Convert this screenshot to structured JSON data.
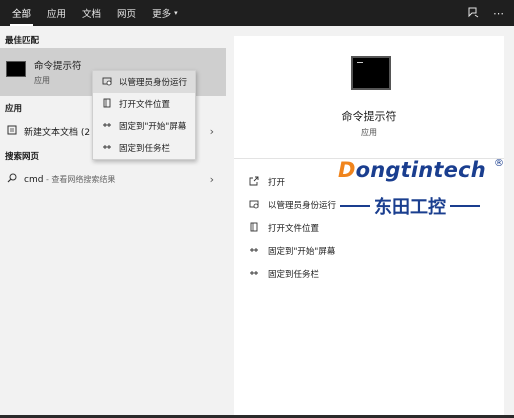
{
  "tabs": {
    "all": "全部",
    "apps": "应用",
    "docs": "文档",
    "web": "网页",
    "more": "更多",
    "more_caret": "▾"
  },
  "top_icons": {
    "feedback": "feedback-icon",
    "more": "⋯"
  },
  "left": {
    "best_match_title": "最佳匹配",
    "best_match": {
      "name": "命令提示符",
      "type": "应用"
    },
    "apps_title": "应用",
    "app_item": {
      "label": "新建文本文档 (2"
    },
    "web_title": "搜索网页",
    "web_item": {
      "label": "cmd",
      "sub": " - 查看网络搜索结果"
    }
  },
  "context_menu": {
    "items": [
      {
        "label": "以管理员身份运行"
      },
      {
        "label": "打开文件位置"
      },
      {
        "label": "固定到\"开始\"屏幕"
      },
      {
        "label": "固定到任务栏"
      }
    ]
  },
  "right": {
    "name": "命令提示符",
    "type": "应用",
    "actions": [
      {
        "label": "打开"
      },
      {
        "label": "以管理员身份运行"
      },
      {
        "label": "打开文件位置"
      },
      {
        "label": "固定到\"开始\"屏幕"
      },
      {
        "label": "固定到任务栏"
      }
    ]
  },
  "watermark": {
    "latin_first": "D",
    "latin_rest": "ongtintech",
    "registered": "®",
    "cn": "东田工控"
  },
  "colors": {
    "topbar": "#1f1f1f",
    "selected": "#cfcfcf",
    "brand_blue": "#1a3e8f",
    "brand_orange": "#f0841c"
  }
}
